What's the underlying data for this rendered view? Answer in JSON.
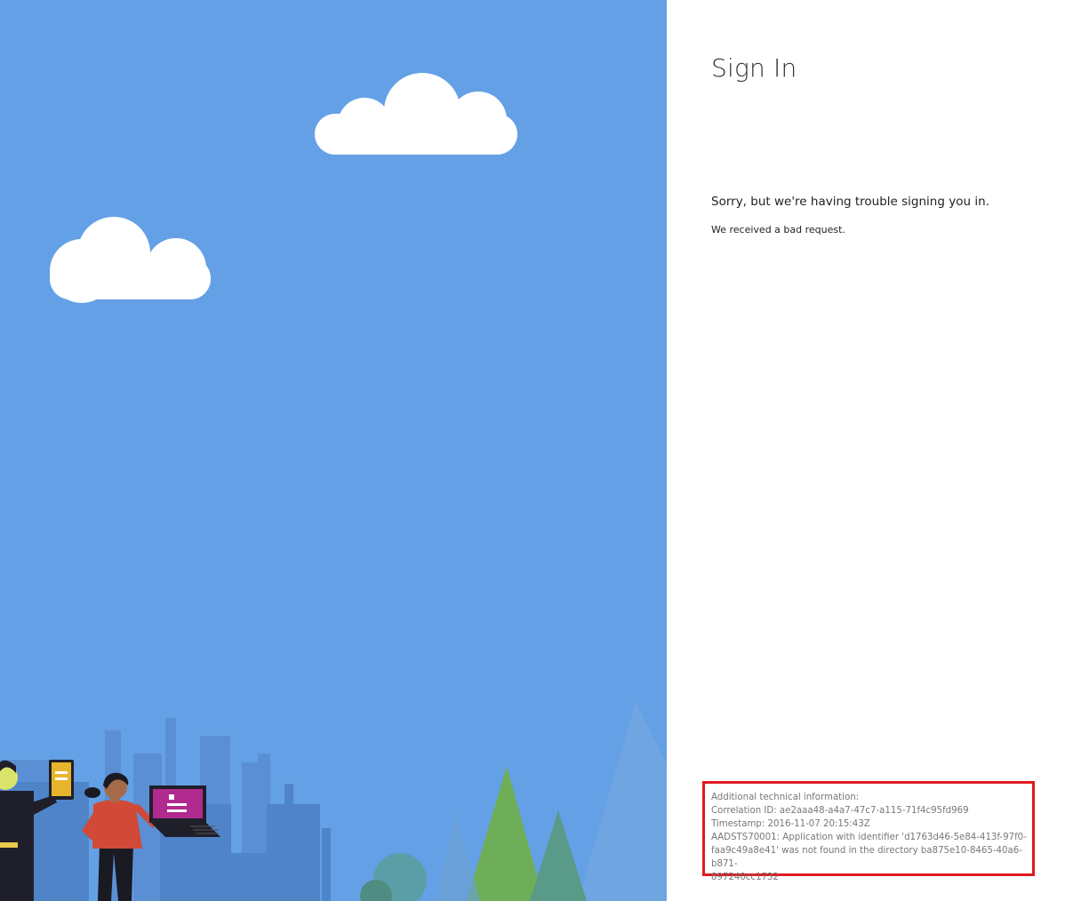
{
  "page": {
    "title": "Sign In",
    "error_heading": "Sorry, but we're having trouble signing you in.",
    "error_detail": "We received a bad request."
  },
  "technical_info": {
    "header": "Additional technical information:",
    "correlation_id": "Correlation ID: ae2aaa48-a4a7-47c7-a115-71f4c95fd969",
    "timestamp": "Timestamp: 2016-11-07 20:15:43Z",
    "error_line1": "AADSTS70001: Application with identifier 'd1763d46-5e84-413f-97f0-",
    "error_line2": "faa9c49a8e41' was not found in the directory ba875e10-8465-40a6-b871-",
    "error_line3": "897240cc1732"
  },
  "colors": {
    "sky": "#64a0e6",
    "highlight_border": "#e0191f",
    "panel_background": "#ffffff"
  },
  "icons": {
    "illustration": "city-people-devices-illustration",
    "cloud": "cloud-icon"
  }
}
